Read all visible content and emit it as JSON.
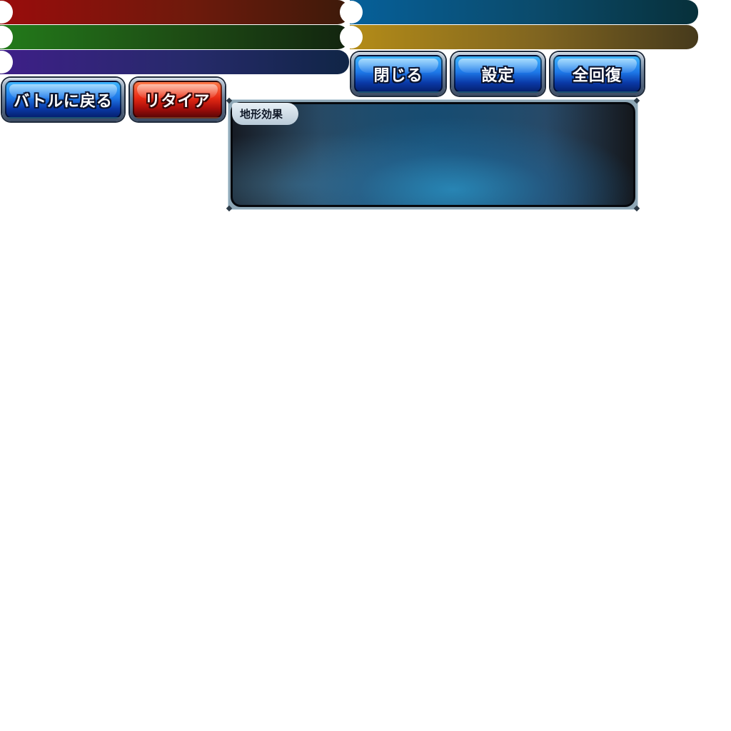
{
  "banners": [
    {
      "name": "red",
      "color": "#9a0c0c"
    },
    {
      "name": "green",
      "color": "#237a1a"
    },
    {
      "name": "purple",
      "color": "#3e1f88"
    },
    {
      "name": "blue",
      "color": "#06609a"
    },
    {
      "name": "gold",
      "color": "#b48c18"
    }
  ],
  "menu": {
    "close_label": "閉じる",
    "settings_label": "設定",
    "heal_label": "全回復"
  },
  "battle": {
    "back_label": "バトルに戻る",
    "retire_label": "リタイア"
  },
  "terrain": {
    "title": "地形効果"
  },
  "colors": {
    "button_blue": "#1e78e8",
    "button_red": "#e82a14",
    "panel_frame": "#8ea7b6"
  }
}
